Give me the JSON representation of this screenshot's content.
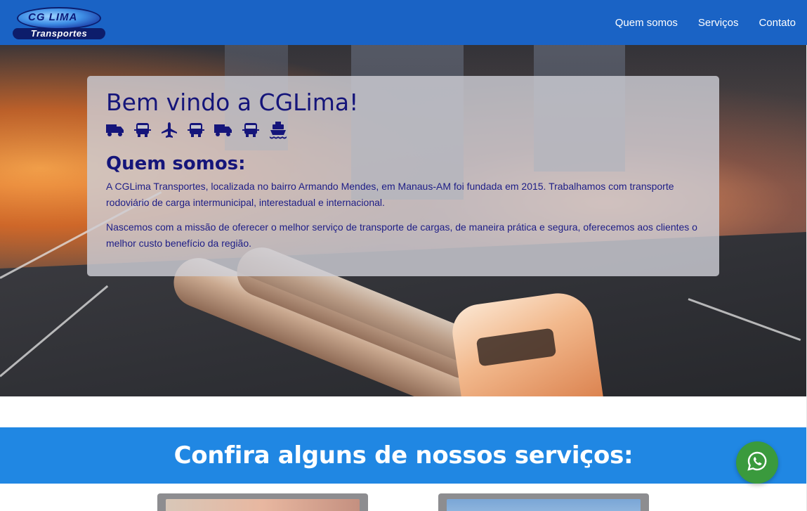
{
  "brand": {
    "logo_top": "CG LIMA",
    "logo_bottom": "Transportes"
  },
  "nav": {
    "items": [
      {
        "label": "Quem somos"
      },
      {
        "label": "Serviços"
      },
      {
        "label": "Contato"
      }
    ]
  },
  "hero": {
    "title": "Bem vindo a CGLima!",
    "icons": [
      "truck-icon",
      "bus-icon",
      "airplane-icon",
      "bus-icon",
      "truck-icon",
      "bus-icon",
      "ship-icon"
    ],
    "about_title": "Quem somos:",
    "paragraphs": [
      "A CGLima Transportes, localizada no bairro Armando Mendes, em Manaus-AM foi fundada em 2015. Trabalhamos com transporte rodoviário de carga intermunicipal, interestadual e internacional.",
      "Nascemos com a missão de oferecer o melhor serviço de transporte de cargas, de maneira prática e segura, oferecemos aos clientes o melhor custo benefício da região."
    ]
  },
  "services": {
    "title": "Confira alguns de nossos serviços:"
  },
  "whatsapp": {
    "icon": "whatsapp-icon"
  },
  "colors": {
    "navbar": "#1a63c5",
    "services_header": "#2087e3",
    "hero_text": "#15157a",
    "whatsapp": "#3a9a3d"
  }
}
